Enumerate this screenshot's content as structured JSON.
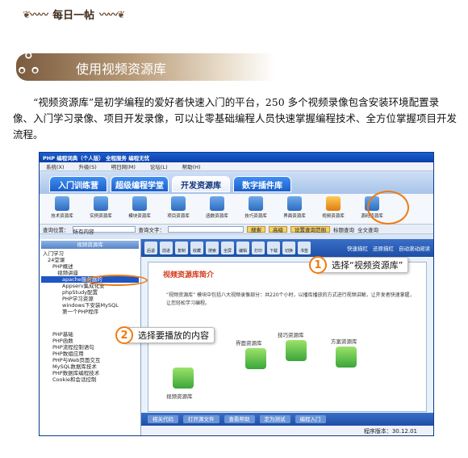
{
  "header": {
    "daily_tag": "每日一帖",
    "section_title": "使用视频资源库"
  },
  "intro": "“视频资源库”是初学编程的爱好者快速入门的平台，250 多个视频录像包含安装环境配置录像、入门学习录像、项目开发录像，可以让零基础编程人员快速掌握编程技术、全方位掌握项目开发流程。",
  "app": {
    "title": "PHP  编程词典（个人版）   全程服务  编程无忧",
    "menu": [
      "系统(X)",
      "升级(S)",
      "明日网(M)",
      "论坛(L)",
      "帮助(H)"
    ],
    "tabs": [
      "入门训练营",
      "超级编程学堂",
      "开发资源库",
      "数字插件库"
    ],
    "active_tab": 2,
    "icons": [
      "技术资源库",
      "实例资源库",
      "模块资源库",
      "项目资源库",
      "函数资源库",
      "技巧资源库",
      "界面资源库",
      "视频资源库",
      "源码资源库"
    ],
    "highlight_icon": 7,
    "query": {
      "pos_label": "查询位置：",
      "pos_value": "所有内容",
      "text_label": "查询文字：",
      "search": "搜索",
      "advanced": "高级",
      "scope": "设置查询范围",
      "opt_title": "标题查询",
      "opt_full": "全文查询"
    },
    "tree": {
      "header": "视频资源库",
      "nodes": [
        "入门学习",
        "24堂课",
        "PHP概述",
        "视频讲座",
        "apache服务器的",
        "Appserv集成化安",
        "phpStudy配置",
        "PHP学习资源",
        "windows下安装MySQL",
        "第一个PHP程序",
        "PHP基础",
        "PHP函数",
        "PHP流程控制语句",
        "PHP数组应用",
        "PHP与Web页面交互",
        "MySQL数据库技术",
        "PHP数据库编程技术",
        "Cookie和会话控制"
      ]
    },
    "toolbar_labels": [
      "后退",
      "前进",
      "复制",
      "收藏",
      "搜索",
      "全屏",
      "编辑",
      "打印",
      "下载",
      "切换",
      "书签"
    ],
    "radios": [
      "快速描红",
      "还原描红",
      "自动滚动阅读"
    ],
    "page": {
      "title": "视频资源库简介",
      "text": "“视频资源库” 模块中包括八大视频录像部分：共220个小时，以播库播放的方式进行视频讲解，让开发者快速掌握，让您轻松学习编程。",
      "labels": [
        "界面资源库",
        "技巧资源库",
        "方案资源库",
        "视频资源库"
      ]
    },
    "bottom_buttons": [
      "相关代码",
      "打开源文件",
      "查看帮助",
      "定为测试",
      "编程入门"
    ],
    "status": "程序版本：30.12.01"
  },
  "callouts": [
    {
      "num": "1",
      "text": "选择“视频资源库”"
    },
    {
      "num": "2",
      "text": "选择要播放的内容"
    }
  ]
}
